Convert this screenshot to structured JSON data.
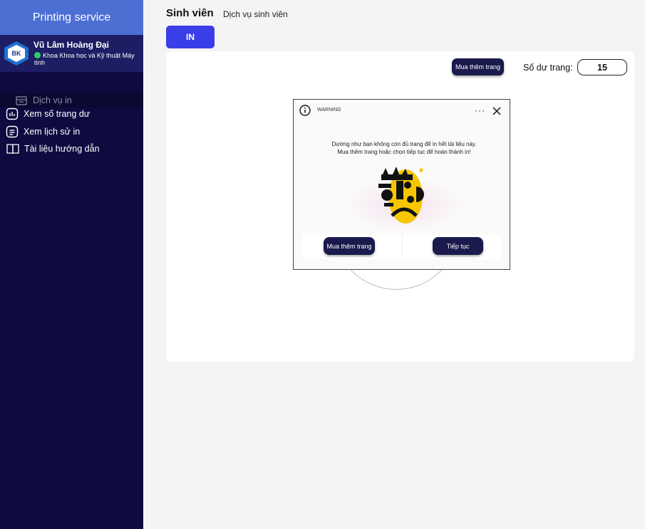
{
  "sidebar": {
    "brand": "Printing service",
    "user": {
      "name": "Vũ Lâm Hoàng Đại",
      "department": "Khoa Khoa học và Kỹ thuật Máy tính",
      "status_color": "#2ecc71"
    },
    "logo_text": "BK",
    "items": [
      {
        "label": "Dịch vụ in",
        "icon": "printer-icon",
        "active": true
      },
      {
        "label": "Xem số trang dư",
        "icon": "chart-icon",
        "active": false
      },
      {
        "label": "Xem lịch sử in",
        "icon": "document-list-icon",
        "active": false
      },
      {
        "label": "Tài liệu hướng dẫn",
        "icon": "book-icon",
        "active": false
      }
    ]
  },
  "header": {
    "title": "Sinh viên",
    "subtitle": "Dịch vụ sinh viên",
    "print_button": "IN"
  },
  "card": {
    "buy_pages_button": "Mua thêm trang",
    "balance_label": "Số dư trang:",
    "balance_value": "15"
  },
  "modal": {
    "title": "WARNING",
    "message_line1": "Dường như bạn không còn đủ trang để in hết tài liệu này.",
    "message_line2": "Mua thêm trang hoặc chọn tiếp tục để hoàn thành in!",
    "buy_button": "Mua thêm trang",
    "continue_button": "Tiếp tục"
  },
  "colors": {
    "sidebar_bg": "#0d0b3f",
    "brand_bg": "#4c6fd4",
    "primary": "#3a3ee8",
    "dark_button": "#1b1a4d",
    "face": "#f7c600"
  }
}
